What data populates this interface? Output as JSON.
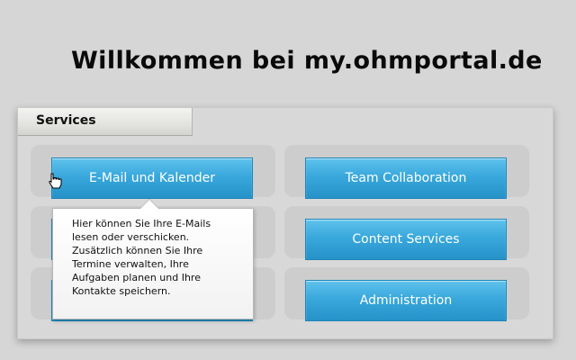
{
  "header": {
    "title": "Willkommen bei my.ohmportal.de"
  },
  "services": {
    "tab_label": "Services",
    "buttons": [
      {
        "label": "E-Mail und Kalender"
      },
      {
        "label": "Team Collaboration"
      },
      {
        "label": "Content Services"
      },
      {
        "label": "Administration"
      }
    ],
    "tooltip": "Hier können Sie Ihre E-Mails\nlesen oder verschicken.\nZusätzlich können Sie Ihre\nTermine verwalten, Ihre\nAufgaben planen und Ihre\nKontakte speichern."
  },
  "icons": {
    "cursor": "hand-pointer-icon"
  },
  "colors": {
    "background": "#d6d6d6",
    "button_accent": "#39a8dc",
    "button_text": "#ffffff"
  }
}
